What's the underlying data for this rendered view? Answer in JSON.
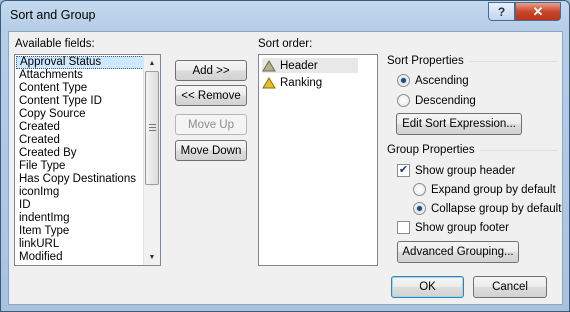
{
  "window": {
    "title": "Sort and Group",
    "help_label": "?",
    "close_label": "✕"
  },
  "available_fields": {
    "label": "Available fields:",
    "items": [
      "Approval Status",
      "Attachments",
      "Content Type",
      "Content Type ID",
      "Copy Source",
      "Created",
      "Created",
      "Created By",
      "File Type",
      "Has Copy Destinations",
      "iconImg",
      "ID",
      "indentImg",
      "Item Type",
      "linkURL",
      "Modified"
    ],
    "selected_index": 0
  },
  "buttons": {
    "add": "Add >>",
    "remove": "<< Remove",
    "move_up": "Move Up",
    "move_down": "Move Down",
    "edit_sort": "Edit Sort Expression...",
    "advanced_grouping": "Advanced Grouping...",
    "ok": "OK",
    "cancel": "Cancel"
  },
  "sort_order": {
    "label": "Sort order:",
    "items": [
      {
        "label": "Header",
        "icon": "ascending-triangle-icon",
        "color": "#b7b08a"
      },
      {
        "label": "Ranking",
        "icon": "ascending-triangle-icon",
        "color": "#e3c02c"
      }
    ],
    "selected_index": 0
  },
  "sort_properties": {
    "heading": "Sort Properties",
    "ascending_label": "Ascending",
    "descending_label": "Descending",
    "selected": "Ascending"
  },
  "group_properties": {
    "heading": "Group Properties",
    "show_header_label": "Show group header",
    "show_header_checked": true,
    "expand_label": "Expand group by default",
    "collapse_label": "Collapse group by default",
    "selected": "Collapse group by default",
    "show_footer_label": "Show group footer",
    "show_footer_checked": false
  }
}
